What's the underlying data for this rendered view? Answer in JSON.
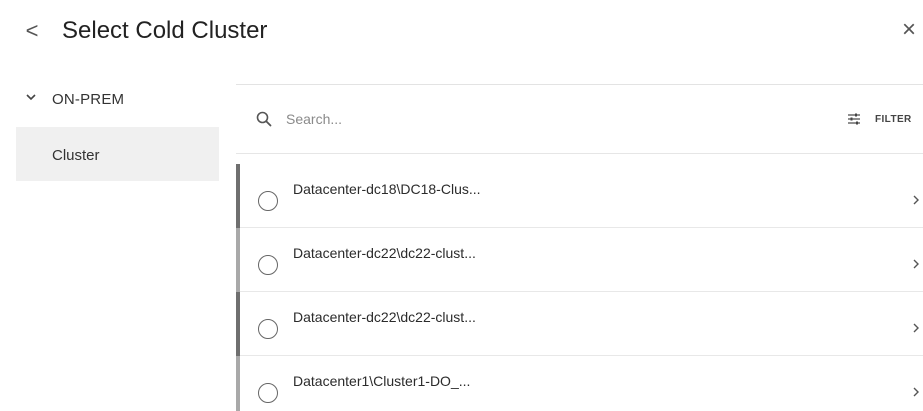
{
  "header": {
    "back_glyph": "<",
    "title": "Select Cold Cluster",
    "close_glyph": "×"
  },
  "sidebar": {
    "group": {
      "label": "ON-PREM",
      "expanded": true,
      "icon": "chevron-down-icon"
    },
    "items": [
      {
        "label": "Cluster",
        "selected": true
      }
    ]
  },
  "search": {
    "placeholder": "Search...",
    "value": "",
    "icon": "search-icon"
  },
  "filter": {
    "label": "FILTER",
    "icon": "sliders-icon"
  },
  "list": {
    "items": [
      {
        "label": "Datacenter-dc18\\DC18-Clus...",
        "selected": false
      },
      {
        "label": "Datacenter-dc22\\dc22-clust...",
        "selected": false
      },
      {
        "label": "Datacenter-dc22\\dc22-clust...",
        "selected": false
      },
      {
        "label": "Datacenter1\\Cluster1-DO_...",
        "selected": false
      }
    ]
  },
  "colors": {
    "nav_selected_bg": "#f0f0f0",
    "row_bar_dark": "#6f6f6f",
    "row_bar_light": "#a9a9a9",
    "divider": "#e6e6e6"
  }
}
